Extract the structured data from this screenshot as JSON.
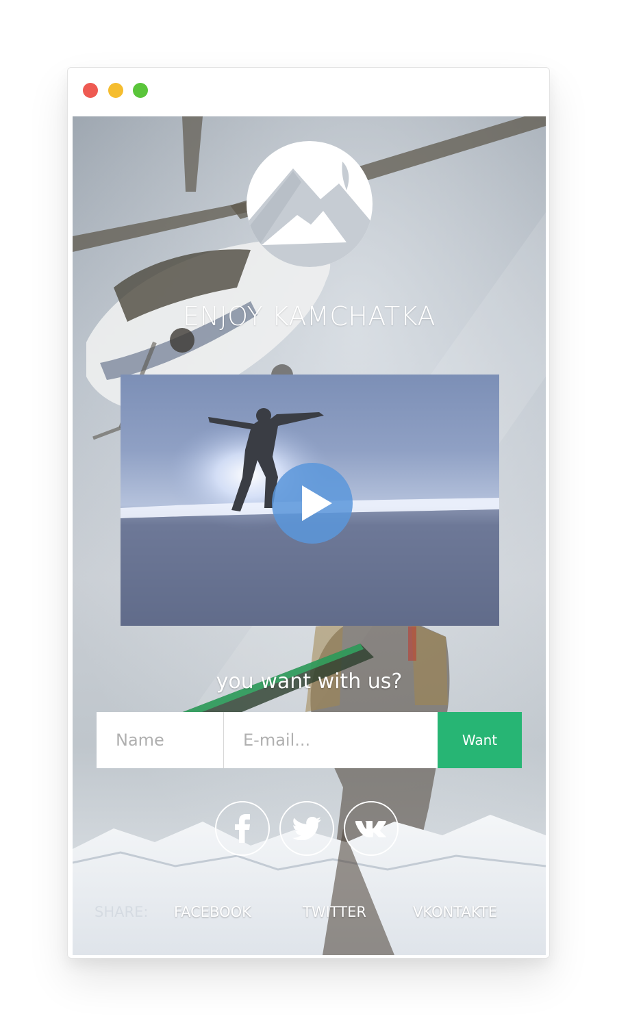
{
  "window": {
    "controls": {
      "close_color": "#ee5a52",
      "minimize_color": "#f5bd2f",
      "maximize_color": "#5ac53a"
    }
  },
  "hero": {
    "logo_icon": "mountain-logo-icon",
    "title": "ENJOY KAMCHATKA"
  },
  "video": {
    "play_icon": "play-icon"
  },
  "form": {
    "question": "you want with us?",
    "name_placeholder": "Name",
    "email_placeholder": "E-mail...",
    "submit_label": "Want",
    "accent_color": "#27b574"
  },
  "social_icons": [
    {
      "icon": "facebook-icon"
    },
    {
      "icon": "twitter-icon"
    },
    {
      "icon": "vk-icon"
    }
  ],
  "share": {
    "label": "SHARE:",
    "links": [
      "FACEBOOK",
      "TWITTER",
      "VKONTAKTE"
    ]
  }
}
